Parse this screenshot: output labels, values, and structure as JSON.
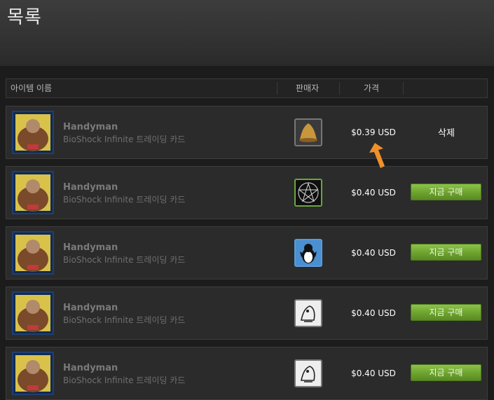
{
  "header": {
    "title": "목록"
  },
  "columns": {
    "item_name": "아이템 이름",
    "seller": "판매자",
    "price": "가격"
  },
  "listings": [
    {
      "name": "Handyman",
      "game": "BioShock Infinite 트레이딩 카드",
      "seller_icon": "bell-icon",
      "price": "$0.39 USD",
      "action": "삭제",
      "action_type": "remove"
    },
    {
      "name": "Handyman",
      "game": "BioShock Infinite 트레이딩 카드",
      "seller_icon": "pentagram-icon",
      "price": "$0.40 USD",
      "action": "지금 구매",
      "action_type": "buy"
    },
    {
      "name": "Handyman",
      "game": "BioShock Infinite 트레이딩 카드",
      "seller_icon": "penguin-icon",
      "price": "$0.40 USD",
      "action": "지금 구매",
      "action_type": "buy"
    },
    {
      "name": "Handyman",
      "game": "BioShock Infinite 트레이딩 카드",
      "seller_icon": "cartoon-character-icon",
      "price": "$0.40 USD",
      "action": "지금 구매",
      "action_type": "buy"
    },
    {
      "name": "Handyman",
      "game": "BioShock Infinite 트레이딩 카드",
      "seller_icon": "cartoon-character-icon",
      "price": "$0.40 USD",
      "action": "지금 구매",
      "action_type": "buy"
    }
  ],
  "colors": {
    "buy_button": "#6ca22e",
    "accent_arrow": "#f0902a"
  }
}
